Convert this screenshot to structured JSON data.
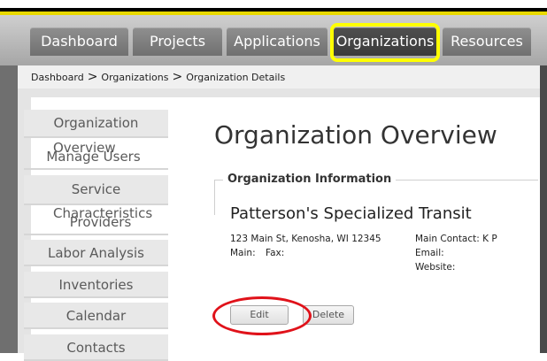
{
  "nav": {
    "tabs": [
      {
        "label": "Dashboard"
      },
      {
        "label": "Projects"
      },
      {
        "label": "Applications"
      },
      {
        "label": "Organizations"
      },
      {
        "label": "Resources"
      }
    ],
    "active_tab": "Organizations"
  },
  "breadcrumb": {
    "items": [
      "Dashboard",
      "Organizations",
      "Organization Details"
    ],
    "separator": ">"
  },
  "sidebar": {
    "items": [
      {
        "label": "Organization Overview"
      },
      {
        "label": "Manage Users"
      },
      {
        "label": "Service Characteristics"
      },
      {
        "label": "Providers"
      },
      {
        "label": "Labor Analysis"
      },
      {
        "label": "Inventories"
      },
      {
        "label": "Calendar"
      },
      {
        "label": "Contacts"
      }
    ]
  },
  "main": {
    "title": "Organization Overview",
    "section_legend": "Organization Information",
    "org_name": "Patterson's Specialized Transit",
    "address": "123 Main St, Kenosha, WI 12345",
    "main_label": "Main:",
    "fax_label": "Fax:",
    "contact_label": "Main Contact: K P",
    "email_label": "Email:",
    "website_label": "Website:"
  },
  "actions": {
    "edit_label": "Edit",
    "delete_label": "Delete"
  },
  "colors": {
    "annotation_yellow": "#ffff00",
    "annotation_red": "#e0121a",
    "active_tab": "#3b3b3b",
    "tab": "#7d7d7d"
  }
}
